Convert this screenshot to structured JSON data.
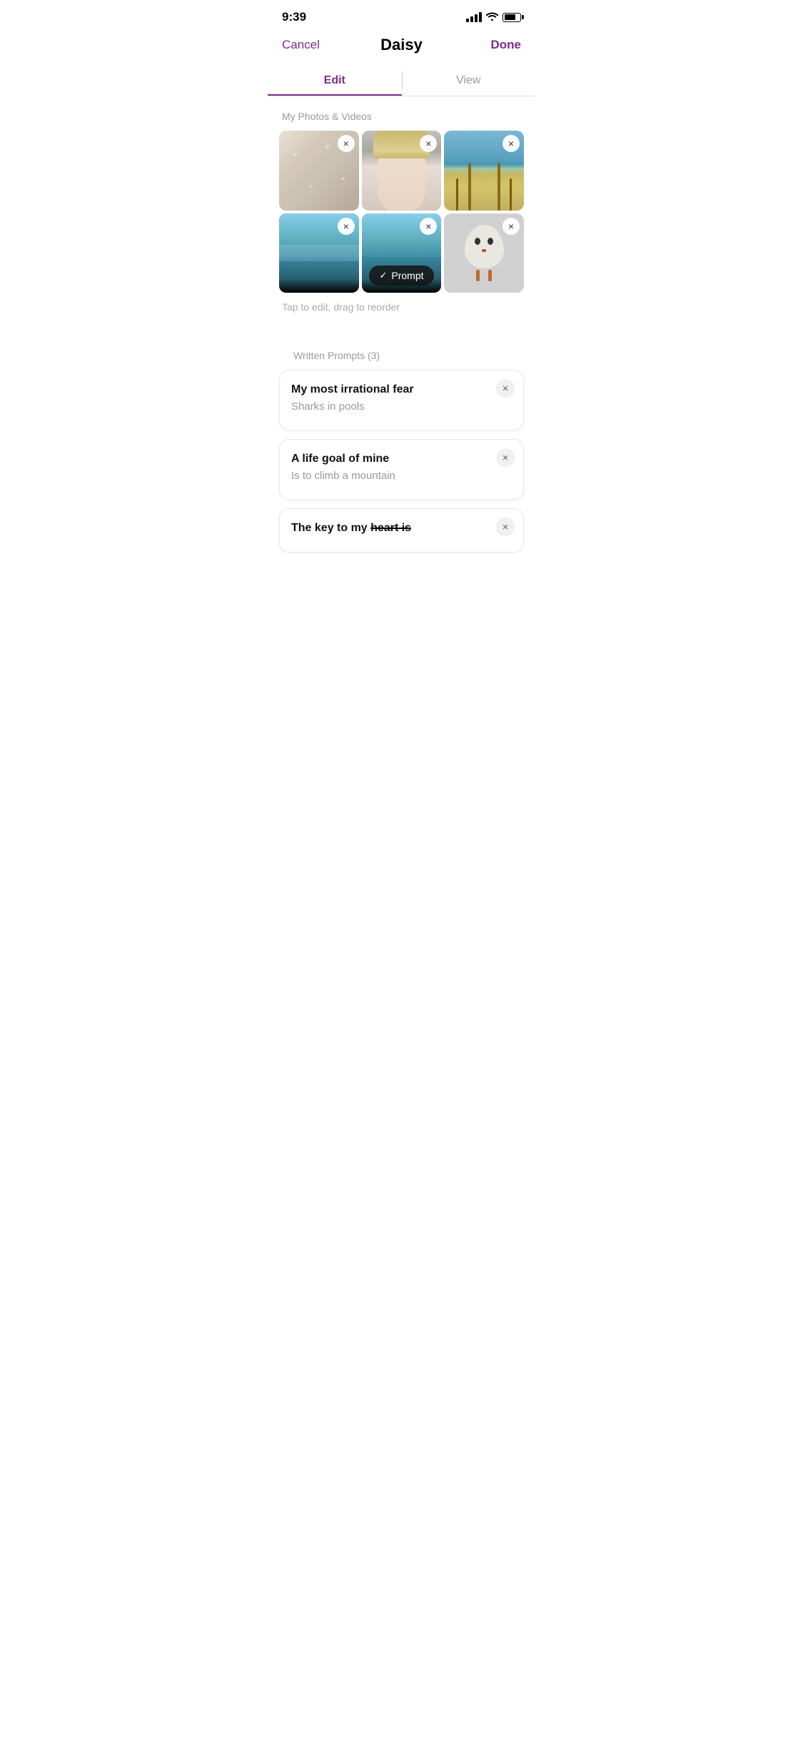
{
  "statusBar": {
    "time": "9:39"
  },
  "header": {
    "cancelLabel": "Cancel",
    "title": "Daisy",
    "doneLabel": "Done"
  },
  "tabs": [
    {
      "label": "Edit",
      "active": true
    },
    {
      "label": "View",
      "active": false
    }
  ],
  "photosSection": {
    "label": "My Photos & Videos",
    "dragHint": "Tap to edit, drag to reorder",
    "photos": [
      {
        "id": "photo-1",
        "type": "texture"
      },
      {
        "id": "photo-2",
        "type": "person"
      },
      {
        "id": "photo-3",
        "type": "beach"
      },
      {
        "id": "photo-4",
        "type": "pool1"
      },
      {
        "id": "photo-5",
        "type": "pool2",
        "hasPrompt": true
      },
      {
        "id": "photo-6",
        "type": "egg"
      }
    ],
    "promptBadge": {
      "check": "✓",
      "label": "Prompt"
    }
  },
  "promptsSection": {
    "label": "Written Prompts (3)",
    "prompts": [
      {
        "id": "prompt-1",
        "title": "My most irrational fear",
        "answer": "Sharks in pools"
      },
      {
        "id": "prompt-2",
        "title": "A life goal of mine",
        "answer": "Is to climb a mountain"
      },
      {
        "id": "prompt-3",
        "title": "The key to my heart is",
        "answer": "",
        "strikethrough": true
      }
    ]
  },
  "icons": {
    "close": "×",
    "check": "✓"
  }
}
